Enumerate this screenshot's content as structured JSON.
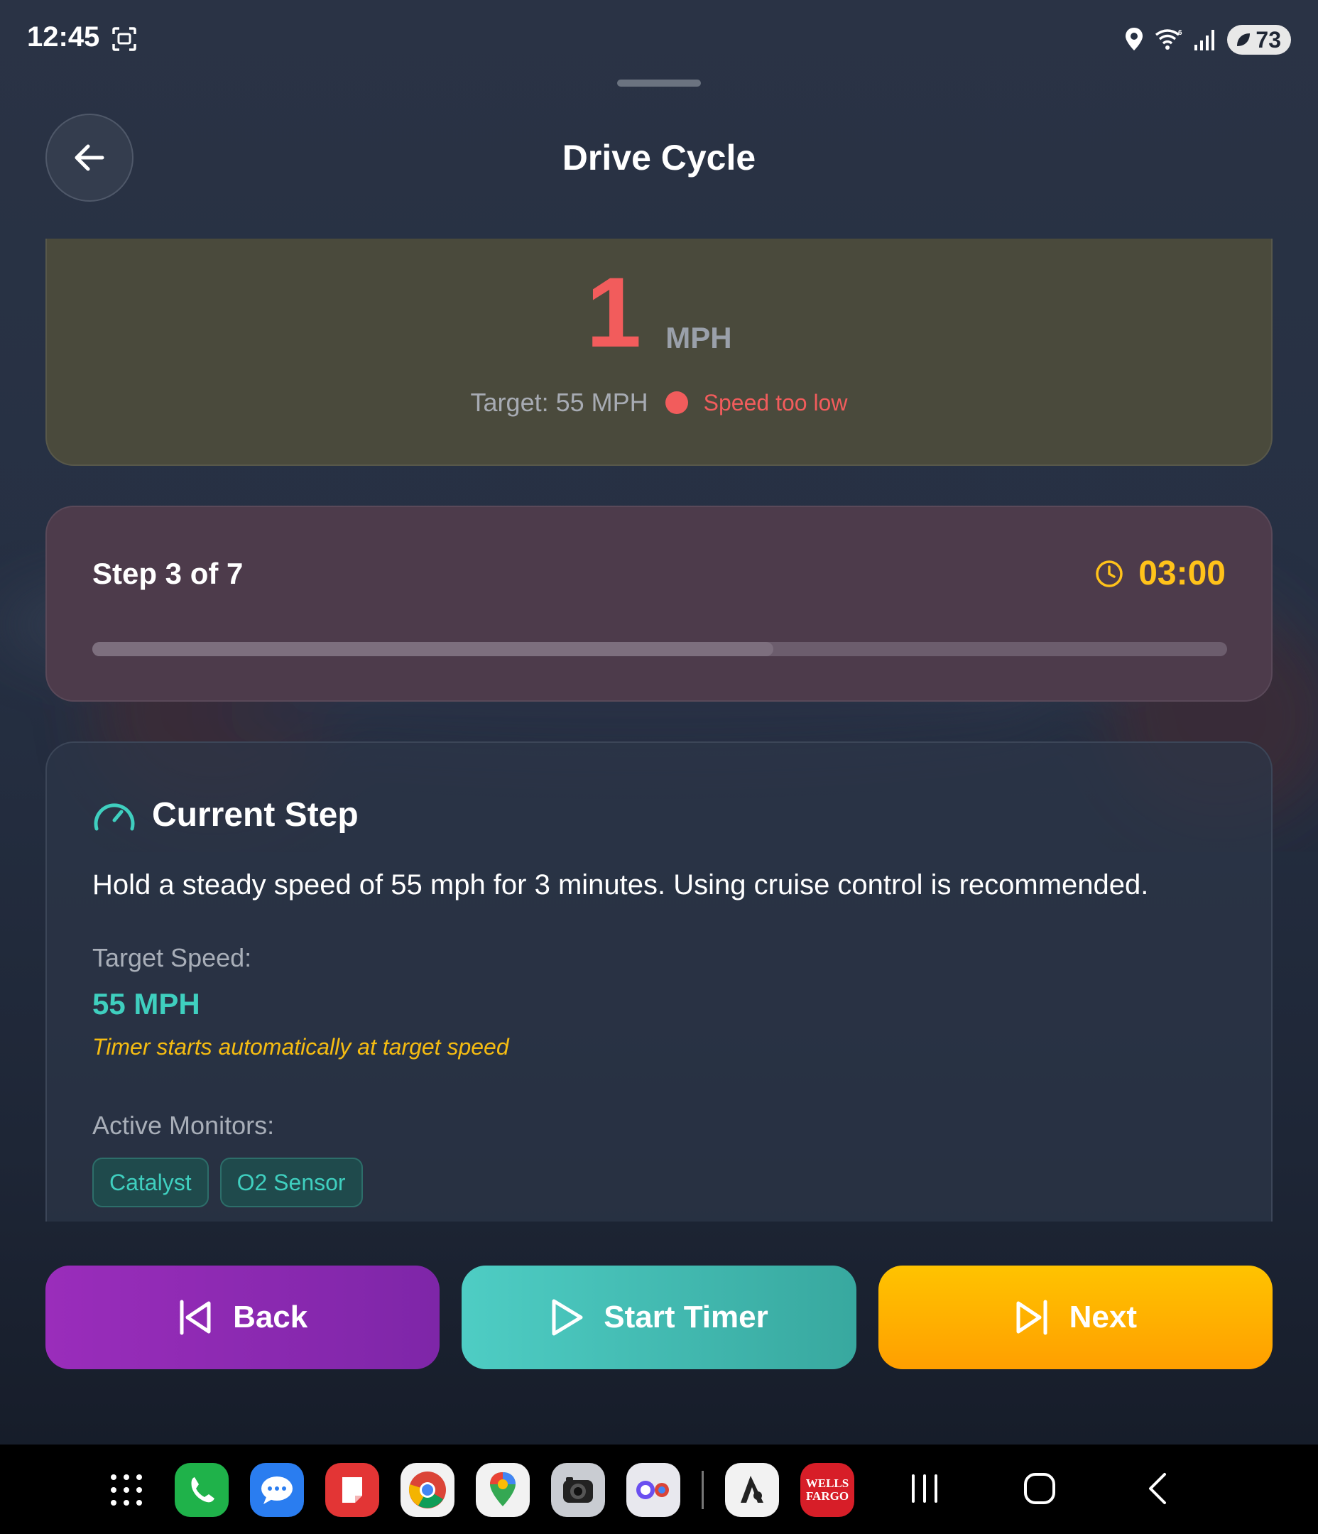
{
  "status_bar": {
    "time": "12:45",
    "battery": "73"
  },
  "header": {
    "title": "Drive Cycle"
  },
  "speed": {
    "value": "1",
    "unit": "MPH",
    "target": "Target: 55 MPH",
    "status": "Speed too low",
    "status_color": "#f25c5c"
  },
  "step": {
    "label": "Step 3 of 7",
    "timer": "03:00",
    "progress_fraction": 0.6
  },
  "current": {
    "title": "Current Step",
    "description": "Hold a steady speed of 55 mph for 3 minutes. Using cruise control is recommended.",
    "target_label": "Target Speed:",
    "target_value": "55 MPH",
    "timer_note": "Timer starts automatically at target speed",
    "monitors_label": "Active Monitors:",
    "monitors": [
      "Catalyst",
      "O2 Sensor"
    ]
  },
  "actions": {
    "back": "Back",
    "start": "Start Timer",
    "next": "Next"
  },
  "dock": {
    "wells_fargo_line1": "WELLS",
    "wells_fargo_line2": "FARGO"
  },
  "colors": {
    "accent_teal": "#3fcfbf",
    "accent_yellow": "#ffc21a",
    "back_purple": "#9a2dbb",
    "next_orange": "#ffa800"
  }
}
